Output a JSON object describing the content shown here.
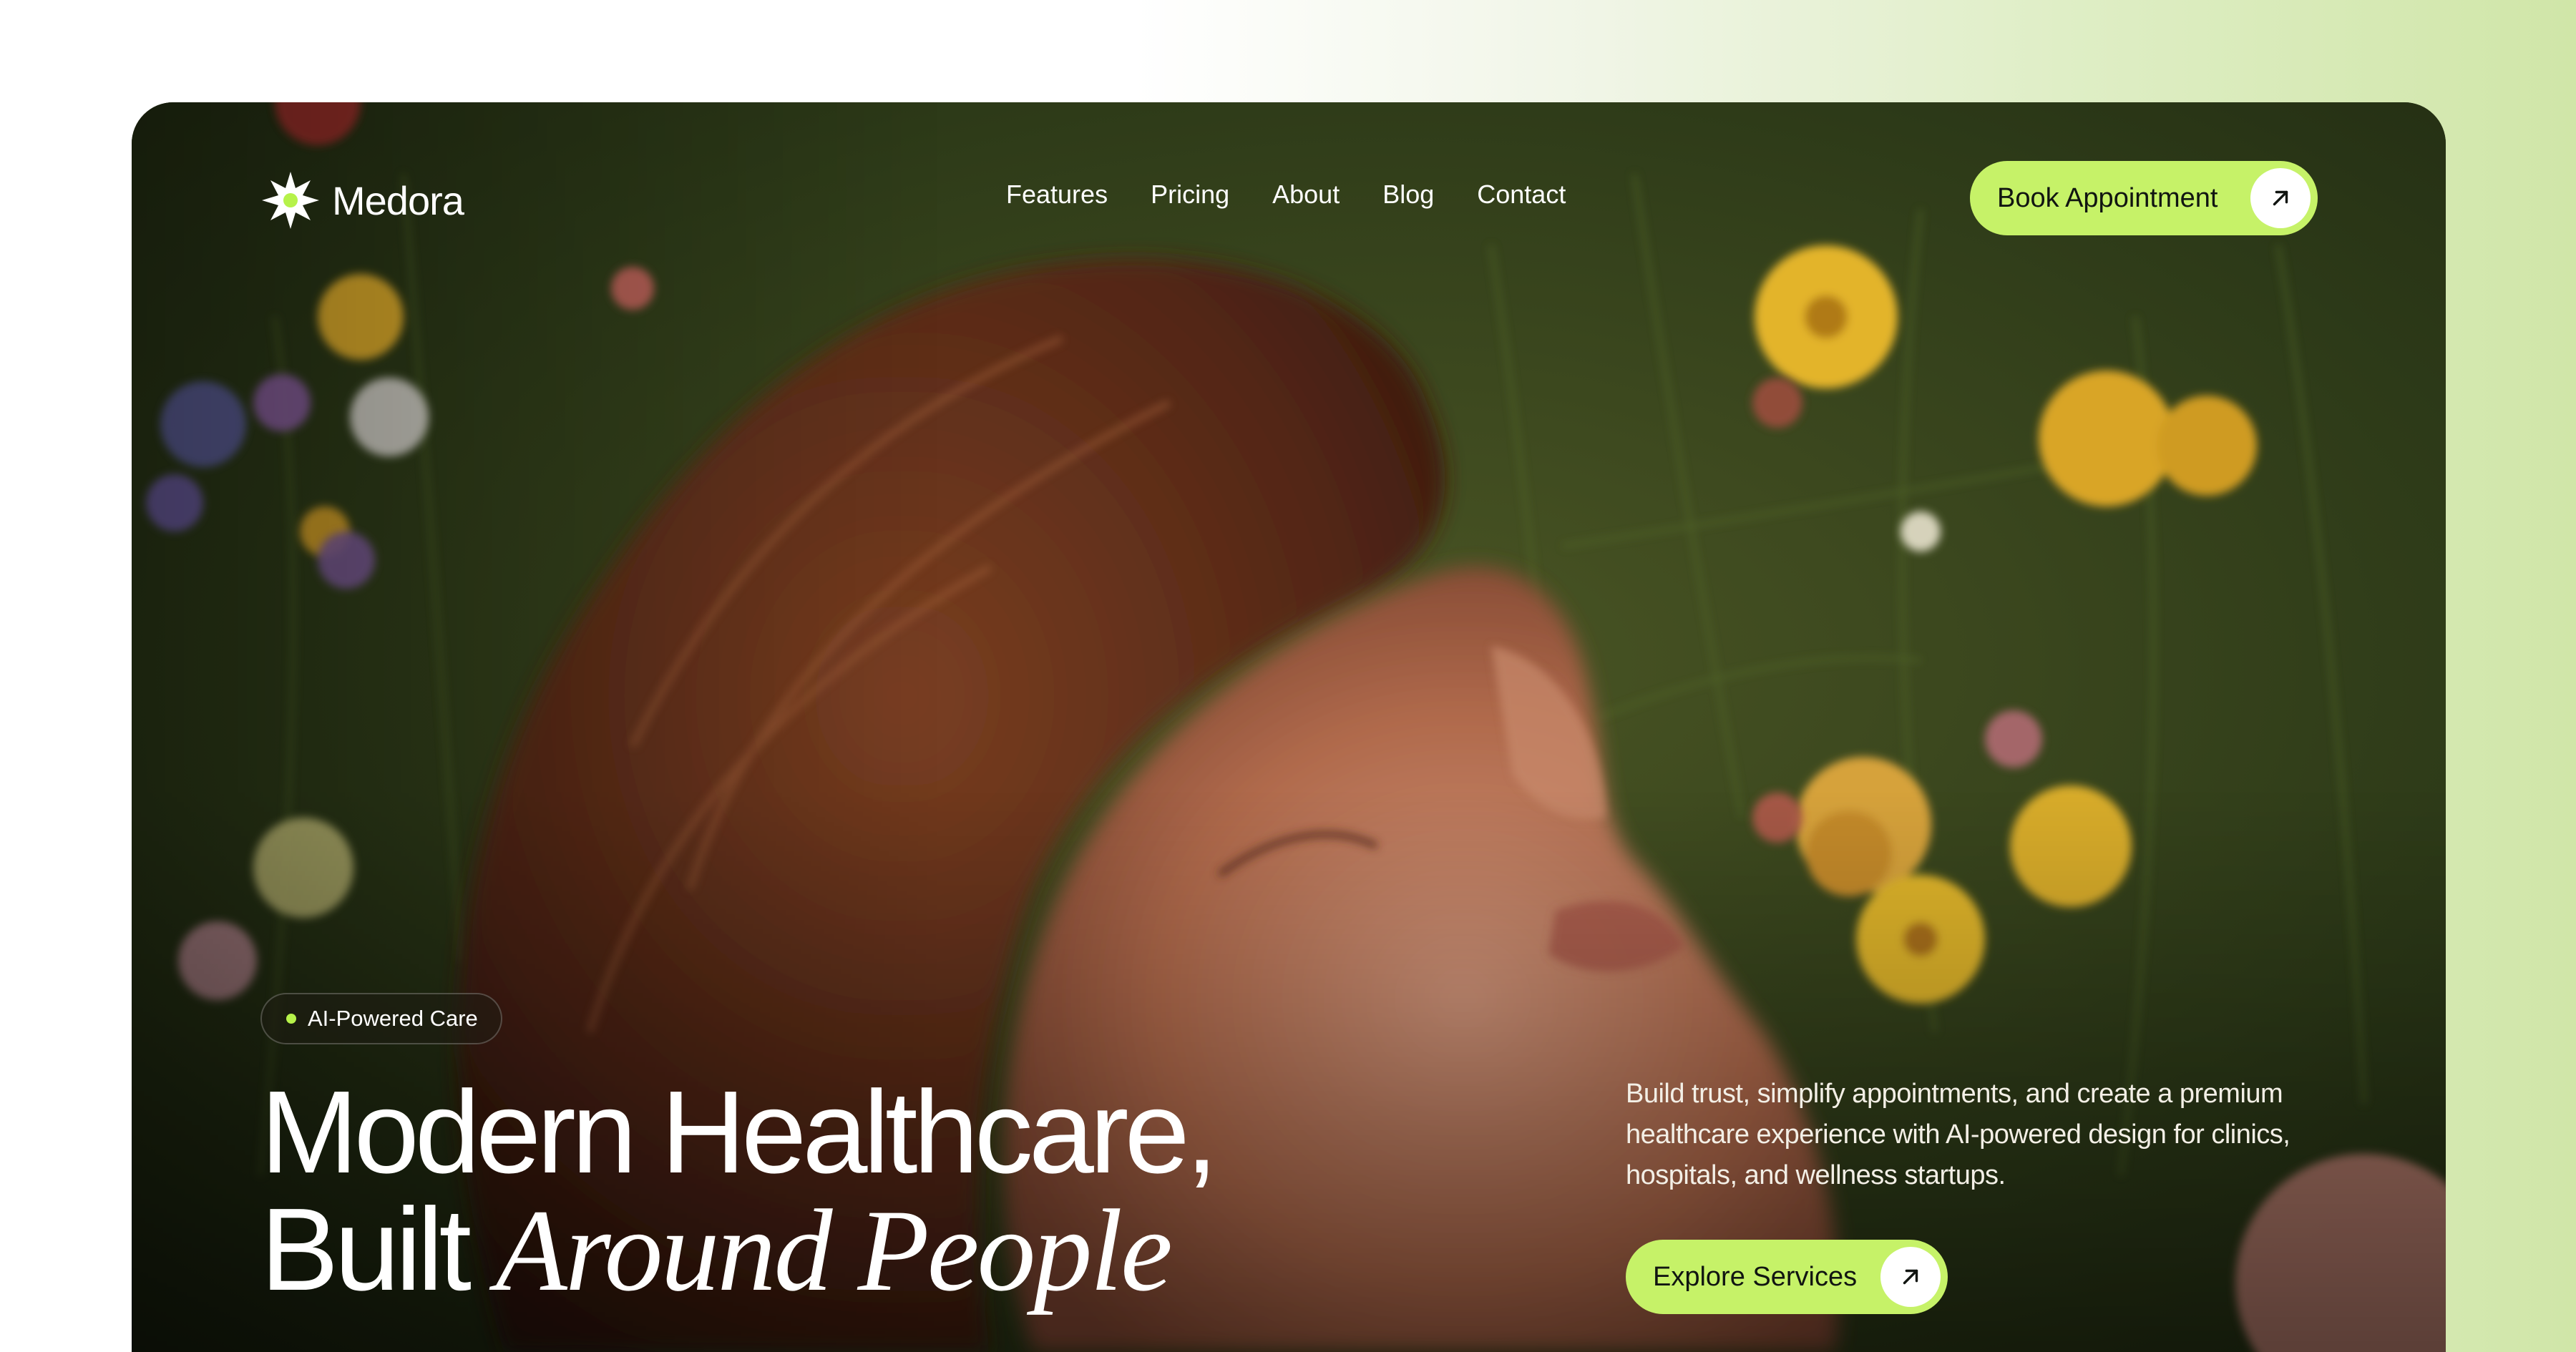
{
  "brand": {
    "name": "Medora",
    "accent_color": "#c6f268"
  },
  "nav": {
    "items": [
      "Features",
      "Pricing",
      "About",
      "Blog",
      "Contact"
    ]
  },
  "header": {
    "cta_label": "Book Appointment",
    "cta_icon": "arrow-up-right-icon"
  },
  "hero": {
    "badge": "AI-Powered Care",
    "headline_line1": "Modern Healthcare,",
    "headline_line2_plain": "Built",
    "headline_line2_italic": "Around People",
    "description": "Build trust, simplify appointments, and create a premium healthcare experience with AI-powered design for clinics, hospitals, and wellness startups.",
    "cta_label": "Explore Services",
    "cta_icon": "arrow-up-right-icon"
  }
}
